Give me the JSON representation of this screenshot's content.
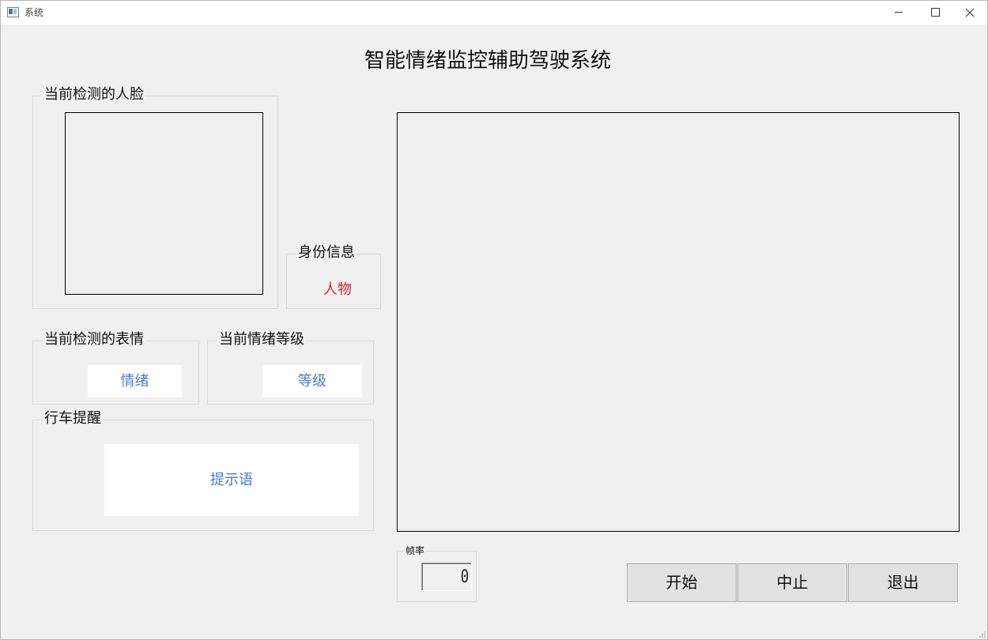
{
  "window": {
    "title": "系统"
  },
  "main_title": "智能情绪监控辅助驾驶系统",
  "face_group": {
    "title": "当前检测的人脸"
  },
  "identity_group": {
    "title": "身份信息",
    "value": "人物"
  },
  "expression_group": {
    "title": "当前检测的表情",
    "value": "情绪"
  },
  "emotion_level_group": {
    "title": "当前情绪等级",
    "value": "等级"
  },
  "driving_alert_group": {
    "title": "行车提醒",
    "value": "提示语"
  },
  "frame_rate_group": {
    "title": "帧率",
    "value": "0"
  },
  "buttons": {
    "start": "开始",
    "stop": "中止",
    "exit": "退出"
  },
  "colors": {
    "label_text_blue": "#4a7bcb",
    "identity_text_red": "#e02020",
    "window_background": "#f0f0f0"
  }
}
